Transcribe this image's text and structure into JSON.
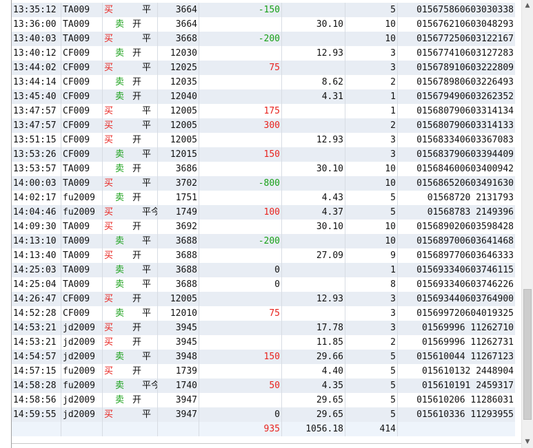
{
  "rows": [
    {
      "time": "13:35:12",
      "inst": "TA009",
      "dir": "买",
      "oc": "平",
      "price": "3664",
      "pnl": "-150",
      "fee": "",
      "vol": "5",
      "id": "015675860603030338"
    },
    {
      "time": "13:36:00",
      "inst": "TA009",
      "dir": "卖",
      "oc": "开",
      "price": "3664",
      "pnl": "",
      "fee": "30.10",
      "vol": "10",
      "id": "015676210603048293"
    },
    {
      "time": "13:40:03",
      "inst": "TA009",
      "dir": "买",
      "oc": "平",
      "price": "3668",
      "pnl": "-200",
      "fee": "",
      "vol": "10",
      "id": "015677250603122167"
    },
    {
      "time": "13:40:12",
      "inst": "CF009",
      "dir": "卖",
      "oc": "开",
      "price": "12030",
      "pnl": "",
      "fee": "12.93",
      "vol": "3",
      "id": "015677410603127283"
    },
    {
      "time": "13:44:02",
      "inst": "CF009",
      "dir": "买",
      "oc": "平",
      "price": "12025",
      "pnl": "75",
      "fee": "",
      "vol": "3",
      "id": "015678910603222809"
    },
    {
      "time": "13:44:14",
      "inst": "CF009",
      "dir": "卖",
      "oc": "开",
      "price": "12035",
      "pnl": "",
      "fee": "8.62",
      "vol": "2",
      "id": "015678980603226493"
    },
    {
      "time": "13:45:40",
      "inst": "CF009",
      "dir": "卖",
      "oc": "开",
      "price": "12040",
      "pnl": "",
      "fee": "4.31",
      "vol": "1",
      "id": "015679490603262352"
    },
    {
      "time": "13:47:57",
      "inst": "CF009",
      "dir": "买",
      "oc": "平",
      "price": "12005",
      "pnl": "175",
      "fee": "",
      "vol": "1",
      "id": "015680790603314134"
    },
    {
      "time": "13:47:57",
      "inst": "CF009",
      "dir": "买",
      "oc": "平",
      "price": "12005",
      "pnl": "300",
      "fee": "",
      "vol": "2",
      "id": "015680790603314133"
    },
    {
      "time": "13:51:15",
      "inst": "CF009",
      "dir": "买",
      "oc": "开",
      "price": "12005",
      "pnl": "",
      "fee": "12.93",
      "vol": "3",
      "id": "015683340603367083"
    },
    {
      "time": "13:53:26",
      "inst": "CF009",
      "dir": "卖",
      "oc": "平",
      "price": "12015",
      "pnl": "150",
      "fee": "",
      "vol": "3",
      "id": "015683790603394409"
    },
    {
      "time": "13:53:57",
      "inst": "TA009",
      "dir": "卖",
      "oc": "开",
      "price": "3686",
      "pnl": "",
      "fee": "30.10",
      "vol": "10",
      "id": "015684600603400942"
    },
    {
      "time": "14:00:03",
      "inst": "TA009",
      "dir": "买",
      "oc": "平",
      "price": "3702",
      "pnl": "-800",
      "fee": "",
      "vol": "10",
      "id": "015686520603491630"
    },
    {
      "time": "14:02:17",
      "inst": "fu2009",
      "dir": "卖",
      "oc": "开",
      "price": "1751",
      "pnl": "",
      "fee": "4.43",
      "vol": "5",
      "id": "01568720    2131793"
    },
    {
      "time": "14:04:46",
      "inst": "fu2009",
      "dir": "买",
      "oc": "平今",
      "price": "1749",
      "pnl": "100",
      "fee": "4.37",
      "vol": "5",
      "id": "01568783    2149396"
    },
    {
      "time": "14:09:30",
      "inst": "TA009",
      "dir": "买",
      "oc": "开",
      "price": "3692",
      "pnl": "",
      "fee": "30.10",
      "vol": "10",
      "id": "015689020603598428"
    },
    {
      "time": "14:13:10",
      "inst": "TA009",
      "dir": "卖",
      "oc": "平",
      "price": "3688",
      "pnl": "-200",
      "fee": "",
      "vol": "10",
      "id": "015689700603641468"
    },
    {
      "time": "14:13:40",
      "inst": "TA009",
      "dir": "买",
      "oc": "开",
      "price": "3688",
      "pnl": "",
      "fee": "27.09",
      "vol": "9",
      "id": "015689770603646333"
    },
    {
      "time": "14:25:03",
      "inst": "TA009",
      "dir": "卖",
      "oc": "平",
      "price": "3688",
      "pnl": "0",
      "fee": "",
      "vol": "1",
      "id": "015693340603746115"
    },
    {
      "time": "14:25:04",
      "inst": "TA009",
      "dir": "卖",
      "oc": "平",
      "price": "3688",
      "pnl": "0",
      "fee": "",
      "vol": "8",
      "id": "015693340603746226"
    },
    {
      "time": "14:26:47",
      "inst": "CF009",
      "dir": "买",
      "oc": "开",
      "price": "12005",
      "pnl": "",
      "fee": "12.93",
      "vol": "3",
      "id": "015693440603764900"
    },
    {
      "time": "14:52:28",
      "inst": "CF009",
      "dir": "卖",
      "oc": "平",
      "price": "12010",
      "pnl": "75",
      "fee": "",
      "vol": "3",
      "id": "015699720604019325"
    },
    {
      "time": "14:53:21",
      "inst": "jd2009",
      "dir": "买",
      "oc": "开",
      "price": "3945",
      "pnl": "",
      "fee": "17.78",
      "vol": "3",
      "id": "01569996    11262710"
    },
    {
      "time": "14:53:21",
      "inst": "jd2009",
      "dir": "买",
      "oc": "开",
      "price": "3945",
      "pnl": "",
      "fee": "11.85",
      "vol": "2",
      "id": "01569996    11262731"
    },
    {
      "time": "14:54:57",
      "inst": "jd2009",
      "dir": "卖",
      "oc": "平",
      "price": "3948",
      "pnl": "150",
      "fee": "29.66",
      "vol": "5",
      "id": "015610044   11267123"
    },
    {
      "time": "14:57:15",
      "inst": "fu2009",
      "dir": "买",
      "oc": "开",
      "price": "1739",
      "pnl": "",
      "fee": "4.40",
      "vol": "5",
      "id": "015610132    2448904"
    },
    {
      "time": "14:58:28",
      "inst": "fu2009",
      "dir": "卖",
      "oc": "平今",
      "price": "1740",
      "pnl": "50",
      "fee": "4.35",
      "vol": "5",
      "id": "015610191    2459317"
    },
    {
      "time": "14:58:56",
      "inst": "jd2009",
      "dir": "卖",
      "oc": "开",
      "price": "3947",
      "pnl": "",
      "fee": "29.65",
      "vol": "5",
      "id": "015610206   11286031"
    },
    {
      "time": "14:59:55",
      "inst": "jd2009",
      "dir": "买",
      "oc": "平",
      "price": "3947",
      "pnl": "0",
      "fee": "29.65",
      "vol": "5",
      "id": "015610336   11293955"
    }
  ],
  "totals": {
    "pnl": "935",
    "fee": "1056.18",
    "vol": "414"
  },
  "colors": {
    "buy": "#e8221d",
    "sell": "#18a018",
    "row_alt": "#e8edf4"
  }
}
